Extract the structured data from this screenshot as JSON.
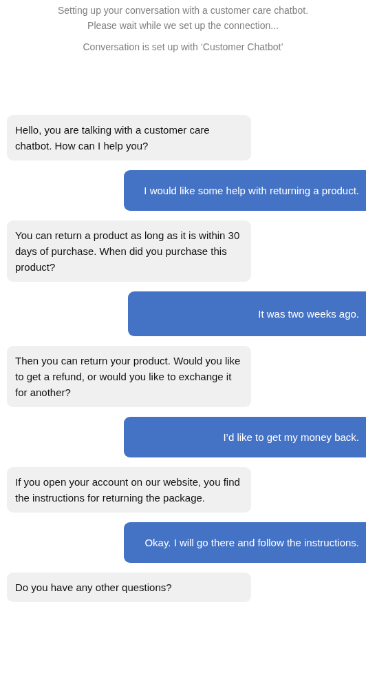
{
  "status_lines": [
    "Setting up your conversation with a customer care chatbot.\nPlease wait while we set up the connection...",
    "Conversation is set up with ‘Customer Chatbot’"
  ],
  "messages": [
    {
      "kind": "bot",
      "text": "Hello, you are talking with a customer care chatbot. How can I help you?"
    },
    {
      "kind": "user",
      "text": "I would like some help with returning a product."
    },
    {
      "kind": "bot",
      "text": "You can return a product as long as it is within 30 days of purchase. When did you purchase this product?"
    },
    {
      "kind": "user",
      "text": "It was two weeks ago."
    },
    {
      "kind": "bot",
      "text": "Then you can return your product. Would you like to get a refund, or would you like to exchange it for another?"
    },
    {
      "kind": "user",
      "text": "I’d like to get my money back."
    },
    {
      "kind": "bot",
      "text": "If you open your account on our website, you find the instructions for returning the package."
    },
    {
      "kind": "user",
      "text": "Okay. I will go there and follow the instructions."
    },
    {
      "kind": "bot",
      "text": "Do you have any other questions?"
    }
  ]
}
